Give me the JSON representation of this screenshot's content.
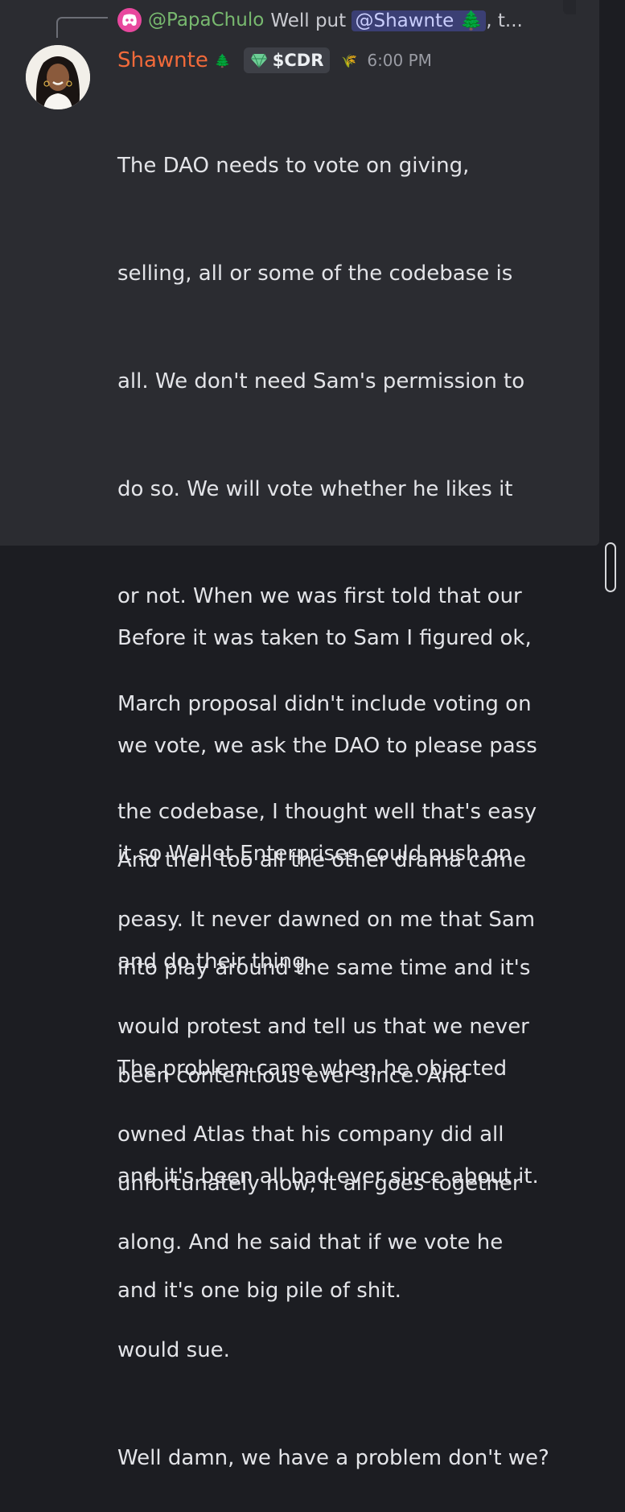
{
  "reply": {
    "username": "@PapaChulo",
    "text": "Well put",
    "mention": "@Shawnte",
    "tree_emoji": "🌲",
    "suffix": ", t..."
  },
  "message": {
    "author": "Shawnte",
    "author_emoji": "🌲",
    "tag": "$CDR",
    "tag_icon": "green-gem-icon",
    "badge_emoji": "🌾",
    "timestamp": "6:00 PM",
    "lines": [
      "The DAO needs to vote on giving,",
      "selling, all or some of the codebase is",
      "all. We don't need Sam's permission to",
      "do so. We will vote whether he likes it",
      "or not. When we was first told that our",
      "March proposal didn't include voting on",
      "the codebase, I thought well that's easy",
      "peasy. It never dawned on me that Sam",
      "would protest and tell us that we never",
      "owned Atlas that his company did all",
      "along. And he said that if we vote he",
      "would sue.",
      "Well damn, we have a problem don't we?"
    ]
  },
  "followups": [
    {
      "lines": [
        "Before it was taken to Sam I figured ok,",
        "we vote, we ask the DAO to please pass",
        "it so Wallet Enterprises could push on",
        "and do their thing.",
        "The problem came when he objected",
        "and it's been all bad ever since about it."
      ]
    },
    {
      "lines": [
        "And then too all the other drama came",
        "into play around the same time and it's",
        "been contentious ever since. And",
        "unfortunately now, it all goes together",
        "and it's one big pile of shit."
      ]
    }
  ],
  "colors": {
    "background": "#1c1d22",
    "highlight": "#2b2c31",
    "username": "#f26a3a",
    "reply_username": "#78b96f",
    "mention_bg": "#3b3f74"
  }
}
